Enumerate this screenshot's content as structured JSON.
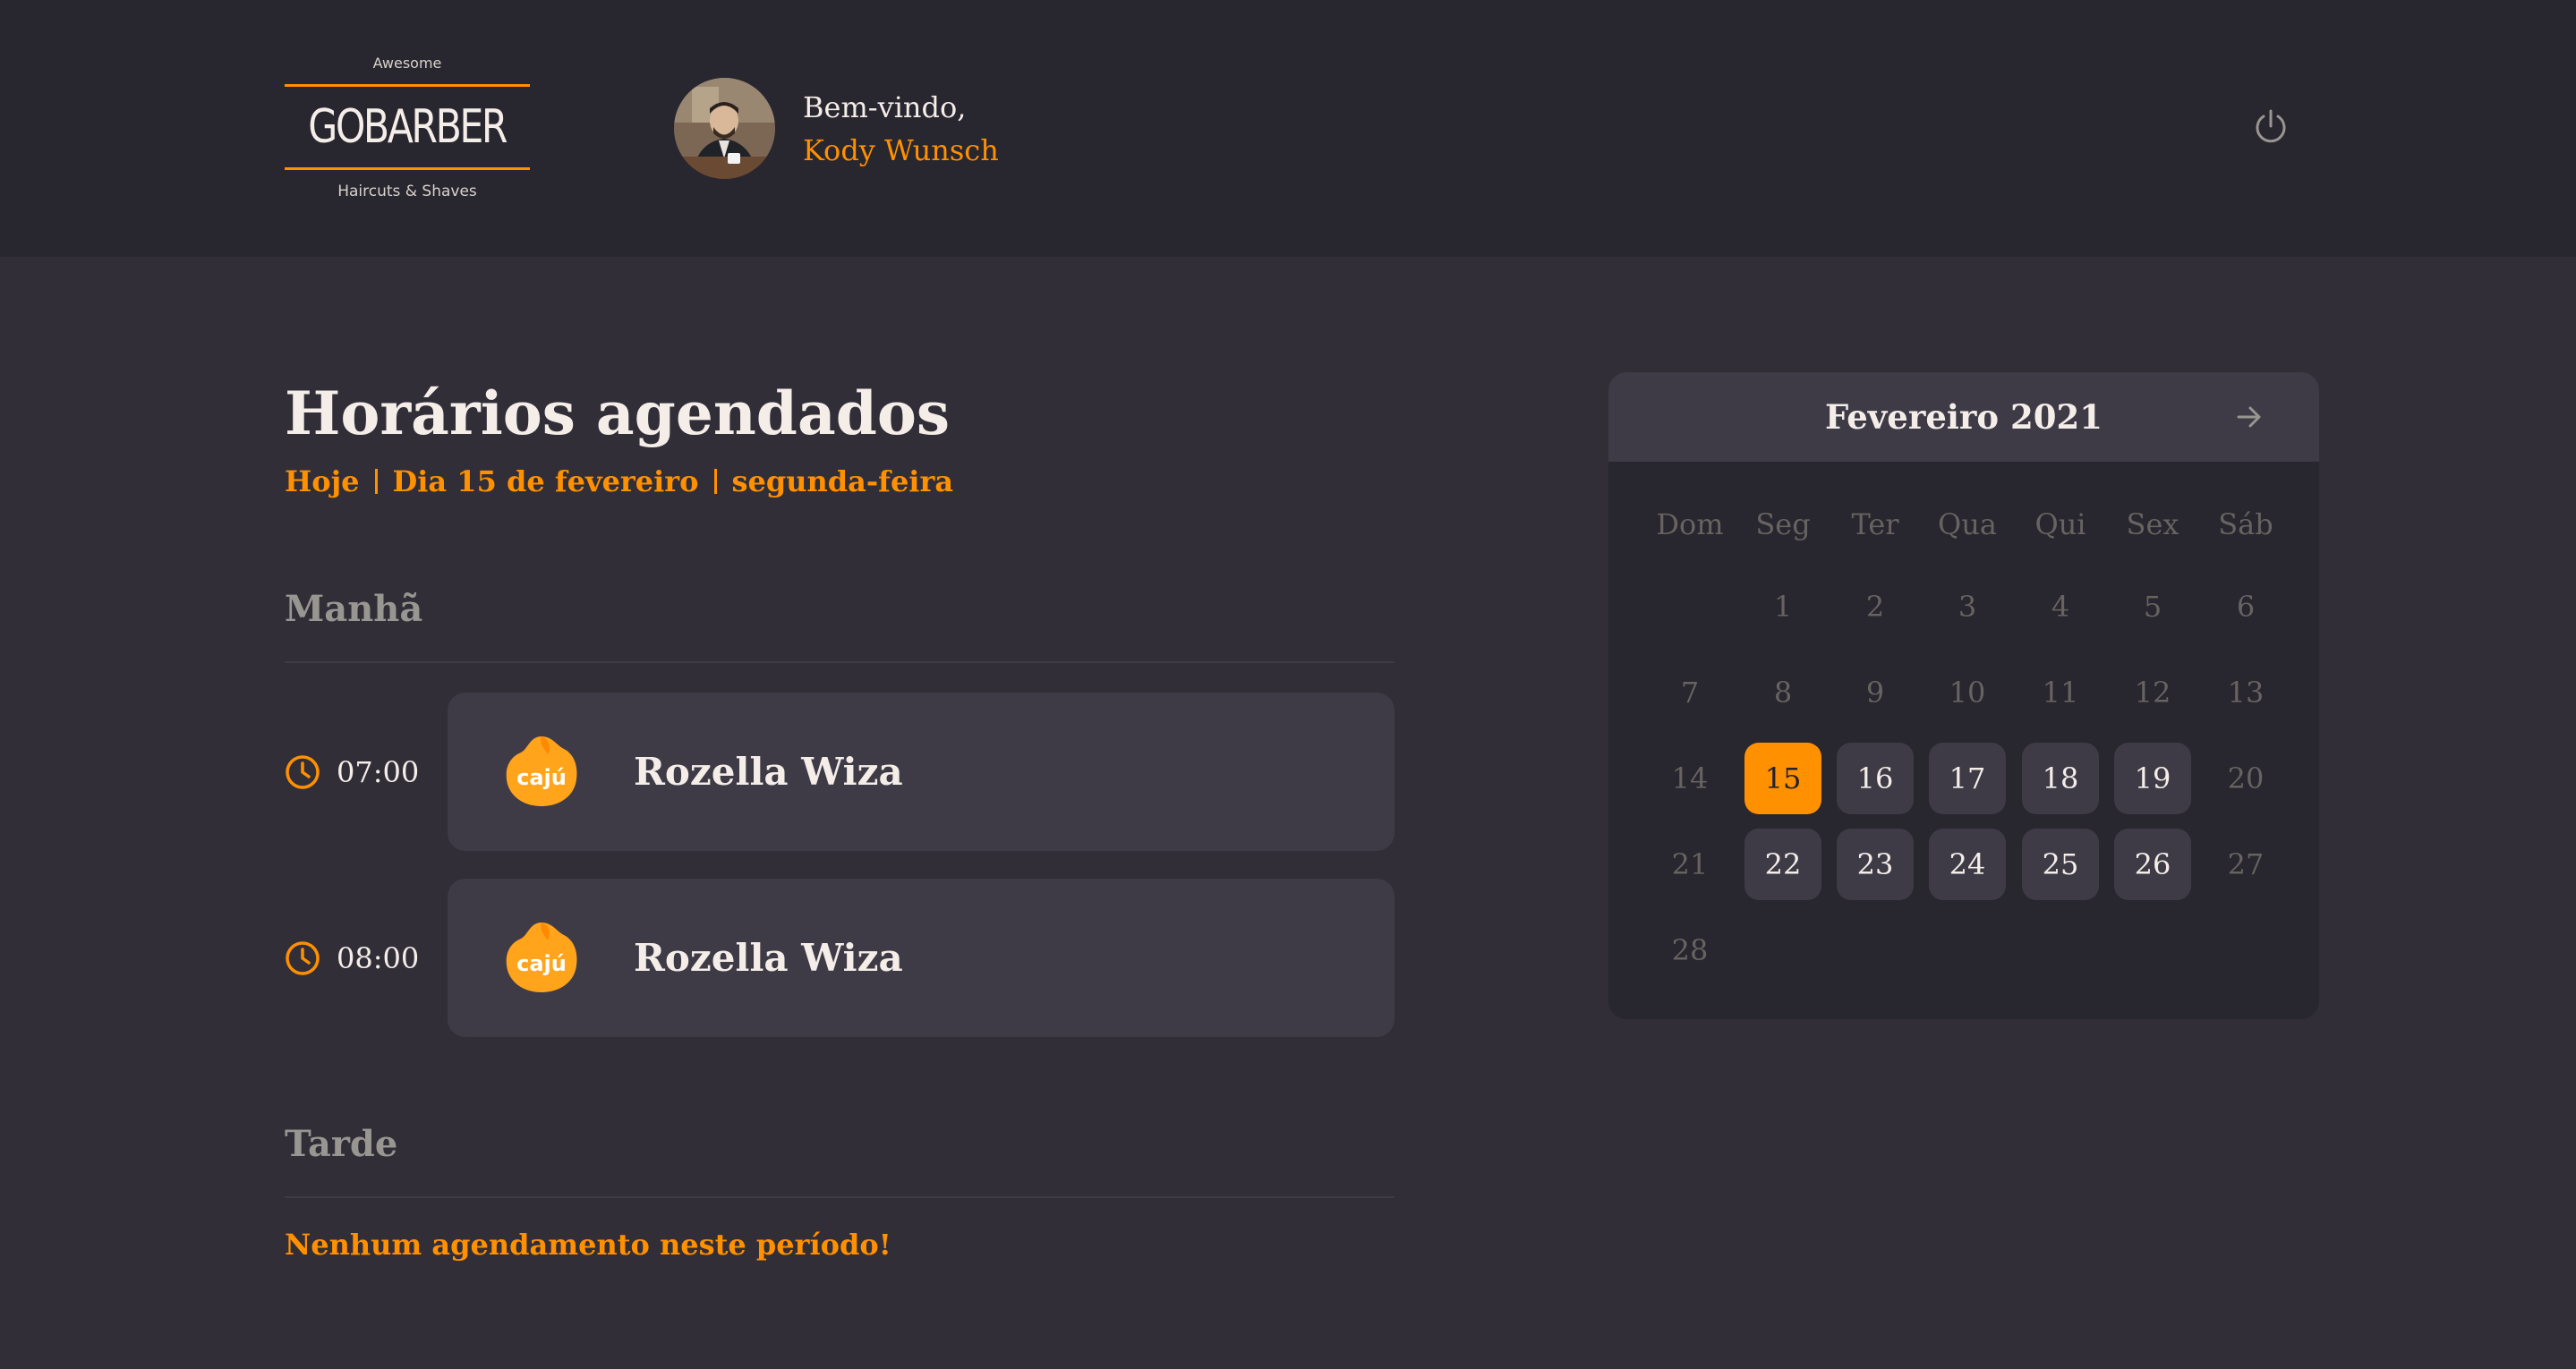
{
  "header": {
    "logo": {
      "top_text": "Awesome",
      "brand": "GOBARBER",
      "bottom_text": "Haircuts & Shaves"
    },
    "greeting": "Bem-vindo,",
    "user_name": "Kody Wunsch",
    "logout_icon": "power-icon"
  },
  "schedule": {
    "title": "Horários agendados",
    "subtitle": {
      "today": "Hoje",
      "date": "Dia 15 de fevereiro",
      "weekday": "segunda-feira"
    },
    "morning": {
      "title": "Manhã",
      "appointments": [
        {
          "time": "07:00",
          "client": "Rozella Wiza",
          "logo_text": "cajú"
        },
        {
          "time": "08:00",
          "client": "Rozella Wiza",
          "logo_text": "cajú"
        }
      ]
    },
    "afternoon": {
      "title": "Tarde",
      "empty_message": "Nenhum agendamento neste período!"
    }
  },
  "calendar": {
    "month_label": "Fevereiro 2021",
    "weekdays": [
      "Dom",
      "Seg",
      "Ter",
      "Qua",
      "Qui",
      "Sex",
      "Sáb"
    ],
    "days": [
      [
        "",
        "1",
        "2",
        "3",
        "4",
        "5",
        "6"
      ],
      [
        "7",
        "8",
        "9",
        "10",
        "11",
        "12",
        "13"
      ],
      [
        "14",
        "15",
        "16",
        "17",
        "18",
        "19",
        "20"
      ],
      [
        "21",
        "22",
        "23",
        "24",
        "25",
        "26",
        "27"
      ],
      [
        "28",
        "",
        "",
        "",
        "",
        "",
        ""
      ]
    ],
    "selected_day": "15",
    "available_days": [
      "15",
      "16",
      "17",
      "18",
      "19",
      "22",
      "23",
      "24",
      "25",
      "26"
    ],
    "accent_color": "#ff9000"
  },
  "colors": {
    "background": "#312e38",
    "header": "#28262e",
    "card": "#3e3b47",
    "accent": "#ff9000",
    "text": "#f4ede8",
    "muted": "#999591"
  }
}
